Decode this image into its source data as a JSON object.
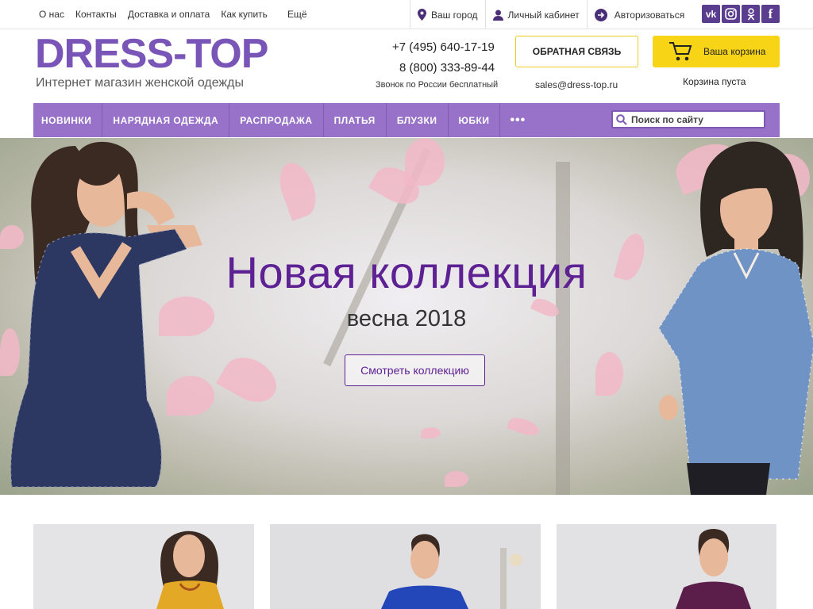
{
  "top_links": [
    "О нас",
    "Контакты",
    "Доставка и оплата",
    "Как купить",
    "Ещё"
  ],
  "top_right": {
    "city": "Ваш город",
    "account": "Личный кабинет",
    "login": "Авторизоваться"
  },
  "social": [
    "vk",
    "instagram",
    "odnoklassniki",
    "facebook"
  ],
  "logo": {
    "title": "DRESS-TOP",
    "subtitle": "Интернет магазин женской одежды"
  },
  "contacts": {
    "phone1": "+7 (495) 640-17-19",
    "phone2": "8 (800) 333-89-44",
    "free_call": "Звонок по России бесплатный",
    "email": "sales@dress-top.ru"
  },
  "callback_label": "ОБРАТНАЯ СВЯЗЬ",
  "cart": {
    "label": "Ваша корзина",
    "status": "Корзина пуста"
  },
  "nav": [
    "НОВИНКИ",
    "НАРЯДНАЯ ОДЕЖДА",
    "РАСПРОДАЖА",
    "ПЛАТЬЯ",
    "БЛУЗКИ",
    "ЮБКИ"
  ],
  "nav_more": "•••",
  "search": {
    "placeholder": "Поиск по сайту"
  },
  "hero": {
    "title": "Новая коллекция",
    "subtitle": "весна 2018",
    "button": "Смотреть коллекцию"
  },
  "colors": {
    "brand_purple": "#9772c8",
    "accent_yellow": "#f7d416",
    "hero_title": "#5d2194"
  }
}
